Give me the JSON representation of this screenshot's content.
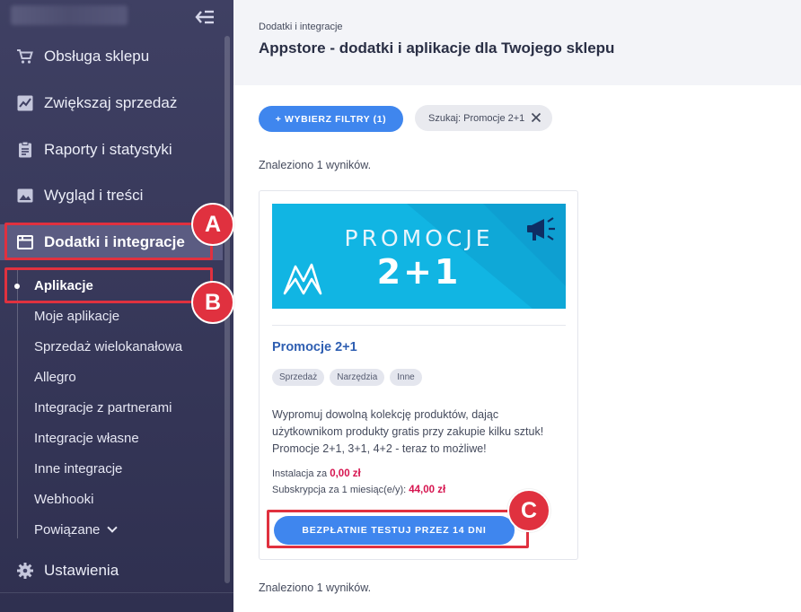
{
  "sidebar": {
    "collapse_icon": "collapse-left-icon",
    "items": [
      {
        "label": "Obsługa sklepu",
        "icon": "cart-icon"
      },
      {
        "label": "Zwiększaj sprzedaż",
        "icon": "chart-icon"
      },
      {
        "label": "Raporty i statystyki",
        "icon": "clipboard-icon"
      },
      {
        "label": "Wygląd i treści",
        "icon": "image-icon"
      },
      {
        "label": "Dodatki i integracje",
        "icon": "window-icon",
        "active": true
      },
      {
        "label": "Ustawienia",
        "icon": "gear-icon"
      }
    ],
    "subitems": [
      {
        "label": "Aplikacje",
        "active": true
      },
      {
        "label": "Moje aplikacje"
      },
      {
        "label": "Sprzedaż wielokanałowa"
      },
      {
        "label": "Allegro"
      },
      {
        "label": "Integracje z partnerami"
      },
      {
        "label": "Integracje własne"
      },
      {
        "label": "Inne integracje"
      },
      {
        "label": "Webhooki"
      },
      {
        "label": "Powiązane"
      }
    ]
  },
  "header": {
    "breadcrumb": "Dodatki i integracje",
    "title": "Appstore - dodatki i aplikacje dla Twojego sklepu"
  },
  "filters": {
    "button_label": "+ WYBIERZ FILTRY (1)",
    "chip_label": "Szukaj: Promocje 2+1"
  },
  "results": {
    "found_top": "Znaleziono 1 wyników.",
    "found_bottom": "Znaleziono 1 wyników."
  },
  "card": {
    "banner_line1": "PROMOCJE",
    "banner_line2": "2+1",
    "title": "Promocje 2+1",
    "tags": [
      "Sprzedaż",
      "Narzędzia",
      "Inne"
    ],
    "description": "Wypromuj dowolną kolekcję produktów, dając użytkownikom produkty gratis przy zakupie kilku sztuk! Promocje 2+1, 3+1, 4+2 - teraz to możliwe!",
    "install_label": "Instalacja za",
    "install_price": "0,00 zł",
    "subscription_label": "Subskrypcja za 1 miesiąc(e/y):",
    "subscription_price": "44,00 zł",
    "cta_label": "BEZPŁATNIE TESTUJ PRZEZ 14 DNI"
  },
  "annotations": {
    "a": "A",
    "b": "B",
    "c": "C",
    "color": "#e0313f"
  },
  "colors": {
    "sidebar_bg": "#3f4063",
    "accent_blue": "#3f86ee",
    "price_red": "#d6144f"
  }
}
